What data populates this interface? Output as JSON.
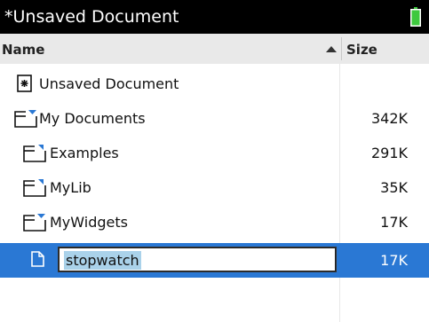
{
  "titlebar": {
    "title": "*Unsaved Document",
    "battery_color": "#3ec93e"
  },
  "columns": {
    "name": "Name",
    "size": "Size"
  },
  "rows": [
    {
      "label": "Unsaved Document",
      "size": "",
      "icon": "document-star-icon"
    },
    {
      "label": "My Documents",
      "size": "342K",
      "icon": "folder-icon"
    },
    {
      "label": "Examples",
      "size": "291K",
      "icon": "folder-icon"
    },
    {
      "label": "MyLib",
      "size": "35K",
      "icon": "folder-icon"
    },
    {
      "label": "MyWidgets",
      "size": "17K",
      "icon": "folder-icon"
    },
    {
      "label": "stopwatch",
      "size": "17K",
      "icon": "document-icon",
      "selected": true,
      "renaming": true
    }
  ],
  "colors": {
    "selection": "#2a78d4",
    "rename_highlight": "#aad2ea",
    "header_bg": "#e9e9e9"
  }
}
